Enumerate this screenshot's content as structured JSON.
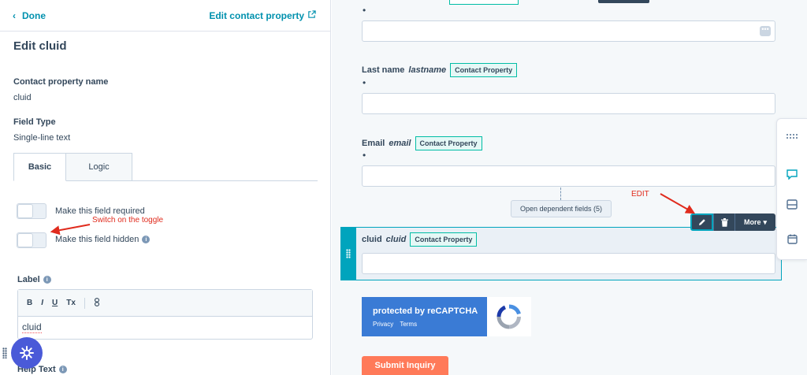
{
  "sidebar": {
    "done_label": "Done",
    "edit_property_link": "Edit contact property",
    "title": "Edit cluid",
    "property_name_label": "Contact property name",
    "property_name_value": "cluid",
    "field_type_label": "Field Type",
    "field_type_value": "Single-line text",
    "tabs": [
      {
        "label": "Basic",
        "active": true
      },
      {
        "label": "Logic",
        "active": false
      }
    ],
    "toggles": [
      {
        "label": "Make this field required",
        "on": false
      },
      {
        "label": "Make this field hidden",
        "on": false
      }
    ],
    "label_heading": "Label",
    "editor_toolbar": [
      "B",
      "I",
      "U",
      "Tx"
    ],
    "label_value": "cluid",
    "help_text_heading": "Help Text"
  },
  "form": {
    "fields": [
      {
        "label": "Last name",
        "internal": "lastname",
        "tag": "Contact Property",
        "required_mark": "•"
      },
      {
        "label": "Email",
        "internal": "email",
        "tag": "Contact Property",
        "required_mark": "•"
      },
      {
        "label": "cluid",
        "internal": "cluid",
        "tag": "Contact Property"
      }
    ],
    "top_required_mark": "•",
    "dependent_button": "Open dependent fields (5)",
    "toolbar_more": "More",
    "recaptcha": {
      "title": "protected by reCAPTCHA",
      "privacy": "Privacy",
      "terms": "Terms"
    },
    "submit_label": "Submit Inquiry"
  },
  "annotations": {
    "toggle_note": "Switch on the toggle",
    "edit_note": "EDIT"
  },
  "colors": {
    "accent": "#0091ae",
    "tag_border": "#00bda5",
    "selected": "#00a4bd",
    "submit": "#ff7a59",
    "annotation": "#e02b1d",
    "recaptcha": "#3a7bd5"
  }
}
